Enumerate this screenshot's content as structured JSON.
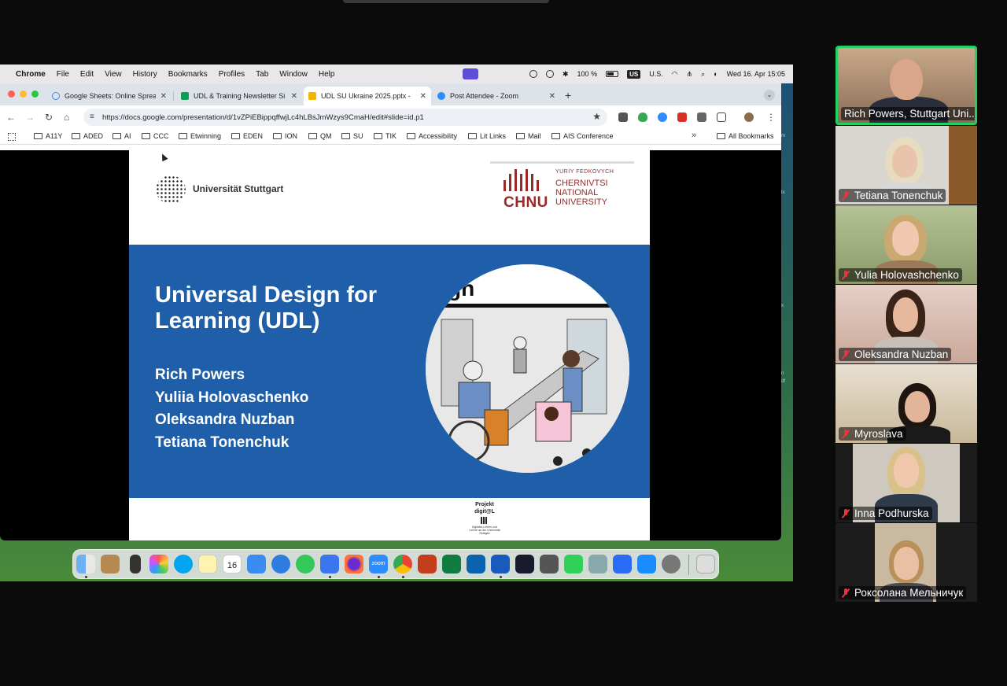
{
  "macos_menubar": {
    "app": "Chrome",
    "menus": [
      "File",
      "Edit",
      "View",
      "History",
      "Bookmarks",
      "Profiles",
      "Tab",
      "Window",
      "Help"
    ],
    "battery": "100 %",
    "keyboard_flag": "US",
    "keyboard_label": "U.S.",
    "datetime": "Wed 16. Apr  15:05"
  },
  "browser": {
    "tabs": [
      {
        "title": "Google Sheets: Online Sprea",
        "icon": "google-icon",
        "color": "#4285f4"
      },
      {
        "title": "UDL & Training Newsletter Si",
        "icon": "sheets-icon",
        "color": "#0f9d58"
      },
      {
        "title": "UDL SU Ukraine 2025.pptx -",
        "icon": "slides-icon",
        "color": "#f4b400",
        "active": true
      },
      {
        "title": "Post Attendee - Zoom",
        "icon": "zoom-icon",
        "color": "#2d8cff"
      }
    ],
    "url": "https://docs.google.com/presentation/d/1vZPiEBippqffwjLc4hLBsJmWzys9CmaH/edit#slide=id.p1",
    "bookmarks": [
      "A11Y",
      "ADED",
      "AI",
      "CCC",
      "Etwinning",
      "EDEN",
      "ION",
      "QM",
      "SU",
      "TIK",
      "Accessibility",
      "Lit Links",
      "Mail",
      "AIS Conference"
    ],
    "more": "»",
    "all_bookmarks": "All Bookmarks"
  },
  "slide": {
    "logo_left": "Universität Stuttgart",
    "logo_right_sub": "YURIY FEDKOVYCH",
    "logo_right_abbr": "CHNU",
    "logo_right_name_1": "CHERNIVTSI",
    "logo_right_name_2": "NATIONAL",
    "logo_right_name_3": "UNIVERSITY",
    "title": "Universal Design for Learning (UDL)",
    "authors": [
      "Rich Powers",
      "Yuliia Holovaschenko",
      "Oleksandra Nuzban",
      "Tetiana Tonenchuk"
    ],
    "image_fragment_text": "gn",
    "footer_project_1": "Projekt",
    "footer_project_2": "digit@L",
    "footer_small": "Digitales Lehren und Lernen an der Universität Stuttgart"
  },
  "side_peek": [
    "m",
    "tx",
    "x",
    "n",
    "df"
  ],
  "dock": {
    "calendar_month": "APR",
    "calendar_day": "16",
    "calendar_badge": "3",
    "zoom_label": "zoom"
  },
  "participants": [
    {
      "name": "Rich Powers, Stuttgart Uni...",
      "muted": false,
      "active": true
    },
    {
      "name": "Tetiana Tonenchuk",
      "muted": true
    },
    {
      "name": "Yulia Holovashchenko",
      "muted": true
    },
    {
      "name": "Oleksandra Nuzban",
      "muted": true
    },
    {
      "name": "Myroslava",
      "muted": true
    },
    {
      "name": "Inna Podhurska",
      "muted": true
    },
    {
      "name": "Роксолана Мельничук",
      "muted": true
    }
  ],
  "colors": {
    "active_speaker": "#23d160",
    "slide_band": "#1f5ea8",
    "chnu_red": "#9a2a2a",
    "mute_red": "#e8353b"
  }
}
